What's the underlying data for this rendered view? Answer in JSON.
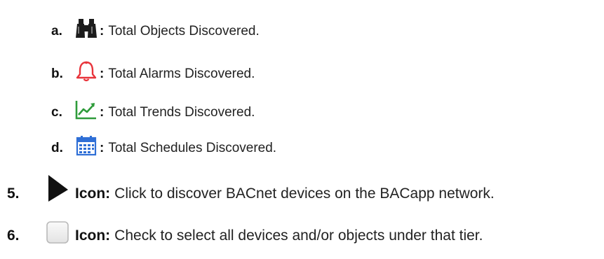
{
  "list": {
    "items": [
      {
        "marker": "a.",
        "colon": ":",
        "text": "Total Objects Discovered.",
        "icon": "binoculars-icon"
      },
      {
        "marker": "b.",
        "colon": ":",
        "text": "Total Alarms Discovered.",
        "icon": "bell-icon"
      },
      {
        "marker": "c.",
        "colon": ":",
        "text": "Total Trends Discovered.",
        "icon": "trend-chart-icon"
      },
      {
        "marker": "d.",
        "colon": ":",
        "text": "Total Schedules Discovered.",
        "icon": "calendar-icon"
      }
    ]
  },
  "steps": [
    {
      "number": "5.",
      "label": "Icon:",
      "text": "Click to discover BACnet devices on the BACapp network.",
      "icon": "play-icon"
    },
    {
      "number": "6.",
      "label": "Icon:",
      "text": "Check to select all devices and/or objects under that tier.",
      "icon": "checkbox-icon"
    }
  ],
  "colors": {
    "bell": "#e8343b",
    "trend": "#2e9b3a",
    "calendar": "#2f6fd6",
    "binoculars": "#1c1c1c"
  }
}
